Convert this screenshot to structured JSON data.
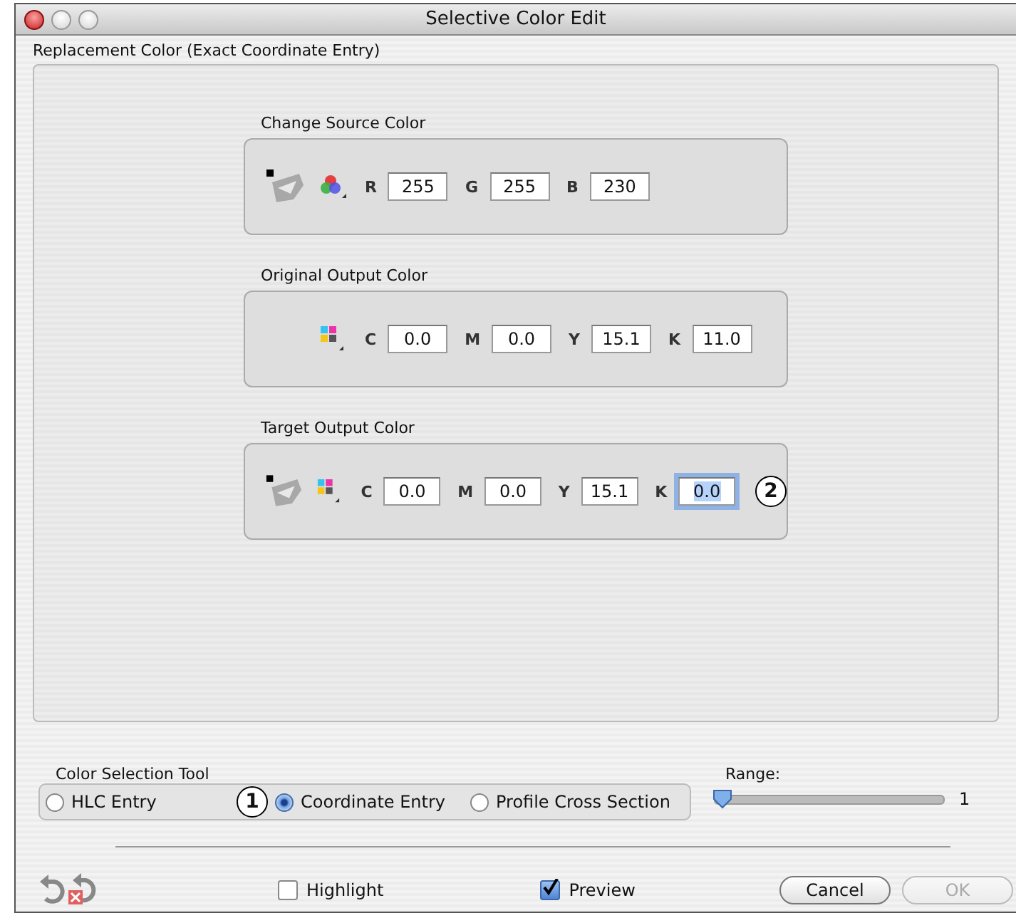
{
  "window": {
    "title": "Selective Color Edit"
  },
  "group": {
    "title": "Replacement Color (Exact Coordinate Entry)"
  },
  "panels": [
    {
      "title": "Change Source Color",
      "eyedropper": true,
      "kind": "rgb",
      "fields": [
        {
          "label": "R",
          "value": "255",
          "focused": false
        },
        {
          "label": "G",
          "value": "255",
          "focused": false
        },
        {
          "label": "B",
          "value": "230",
          "focused": false
        }
      ]
    },
    {
      "title": "Original Output Color",
      "eyedropper": false,
      "kind": "cmyk",
      "fields": [
        {
          "label": "C",
          "value": "0.0",
          "focused": false
        },
        {
          "label": "M",
          "value": "0.0",
          "focused": false
        },
        {
          "label": "Y",
          "value": "15.1",
          "focused": false
        },
        {
          "label": "K",
          "value": "11.0",
          "focused": false
        }
      ]
    },
    {
      "title": "Target Output Color",
      "eyedropper": true,
      "kind": "cmyk",
      "fields": [
        {
          "label": "C",
          "value": "0.0",
          "focused": false
        },
        {
          "label": "M",
          "value": "0.0",
          "focused": false
        },
        {
          "label": "Y",
          "value": "15.1",
          "focused": false
        },
        {
          "label": "K",
          "value": "0.0",
          "focused": true,
          "callout": "2"
        }
      ]
    }
  ],
  "selection_tool": {
    "title": "Color Selection Tool",
    "options": [
      {
        "label": "HLC Entry",
        "selected": false
      },
      {
        "label": "Coordinate Entry",
        "selected": true,
        "callout": "1"
      },
      {
        "label": "Profile Cross Section",
        "selected": false
      }
    ]
  },
  "range": {
    "label": "Range:",
    "level": 0,
    "reading": "1"
  },
  "checkboxes": [
    {
      "label": "Highlight",
      "checked": false
    },
    {
      "label": "Preview",
      "checked": true
    }
  ],
  "buttons": [
    {
      "label": "Cancel",
      "disabled": false
    },
    {
      "label": "OK",
      "disabled": true
    }
  ]
}
